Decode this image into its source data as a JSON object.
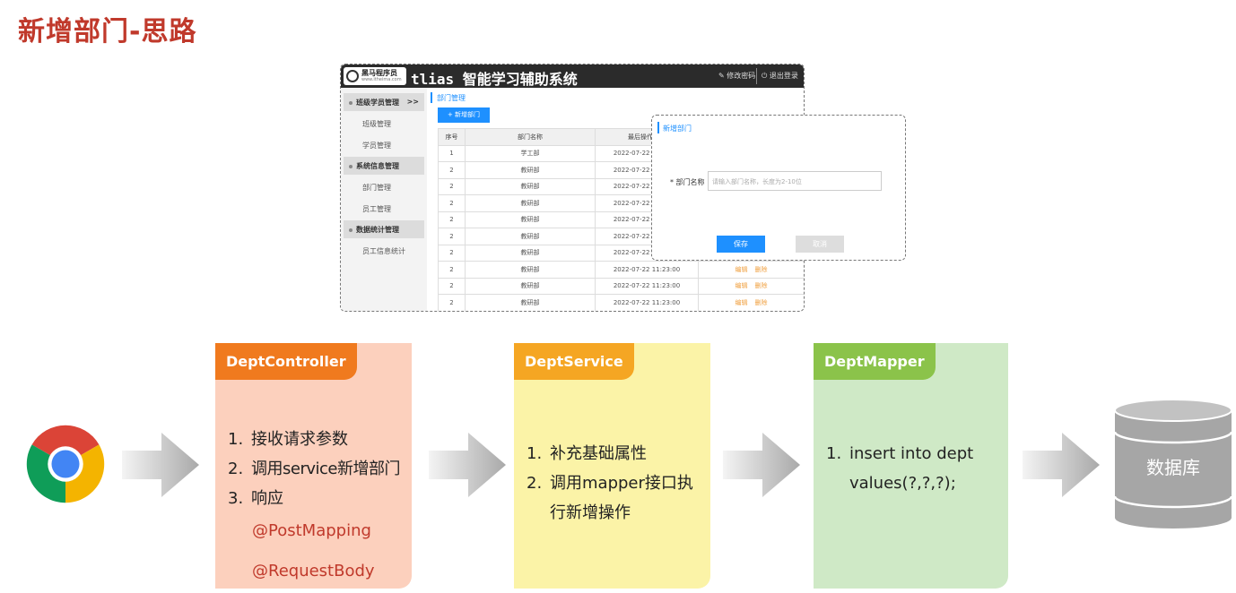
{
  "slide_title": "新增部门-思路",
  "app": {
    "logo_text": "黑马程序员",
    "logo_sub": "www.itheima.com",
    "title": "tlias 智能学习辅助系统",
    "change_password": "修改密码",
    "logout": "退出登录",
    "sidebar": [
      {
        "group": "班级学员管理",
        "chevron": ">>",
        "items": [
          "班级管理",
          "学员管理"
        ]
      },
      {
        "group": "系统信息管理",
        "items": [
          "部门管理",
          "员工管理"
        ]
      },
      {
        "group": "数据统计管理",
        "items": [
          "员工信息统计"
        ]
      }
    ],
    "breadcrumb": "部门管理",
    "add_button": "+ 新增部门",
    "table": {
      "headers": [
        "序号",
        "部门名称",
        "最后操作时间",
        "操作"
      ],
      "action_edit": "编辑",
      "action_delete": "删除",
      "rows": [
        {
          "no": "1",
          "name": "学工部",
          "time": "2022-07-22 11:23:00"
        },
        {
          "no": "2",
          "name": "教研部",
          "time": "2022-07-22 11:23:00"
        },
        {
          "no": "2",
          "name": "教研部",
          "time": "2022-07-22 11:23:00"
        },
        {
          "no": "2",
          "name": "教研部",
          "time": "2022-07-22 11:23:00"
        },
        {
          "no": "2",
          "name": "教研部",
          "time": "2022-07-22 11:23:00"
        },
        {
          "no": "2",
          "name": "教研部",
          "time": "2022-07-22 11:23:00"
        },
        {
          "no": "2",
          "name": "教研部",
          "time": "2022-07-22 11:23:00"
        },
        {
          "no": "2",
          "name": "教研部",
          "time": "2022-07-22 11:23:00"
        },
        {
          "no": "2",
          "name": "教研部",
          "time": "2022-07-22 11:23:00"
        },
        {
          "no": "2",
          "name": "教研部",
          "time": "2022-07-22 11:23:00"
        }
      ]
    },
    "dialog": {
      "title": "新增部门",
      "field_label": "* 部门名称",
      "placeholder": "请输入部门名称，长度为2-10位",
      "save": "保存",
      "cancel": "取消"
    }
  },
  "flow": {
    "controller": {
      "tag": "DeptController",
      "color": "#f07a1e",
      "bg": "#fcd0bd",
      "steps": [
        "接收请求参数",
        "调用service新增部门",
        "响应"
      ],
      "annotations": [
        "@PostMapping",
        "@RequestBody"
      ]
    },
    "service": {
      "tag": "DeptService",
      "color": "#f5a623",
      "bg": "#fbf3a7",
      "steps": [
        "补充基础属性",
        "调用mapper接口执行新增操作"
      ]
    },
    "mapper": {
      "tag": "DeptMapper",
      "color": "#8bc34a",
      "bg": "#cfe9c6",
      "steps": [
        "insert into dept values(?,?,?);"
      ]
    },
    "database": {
      "label": "数据库",
      "color": "#a6a6a6"
    }
  },
  "icons": {
    "browser": "chrome-icon",
    "arrow": "right-arrow-icon",
    "database": "database-icon"
  }
}
